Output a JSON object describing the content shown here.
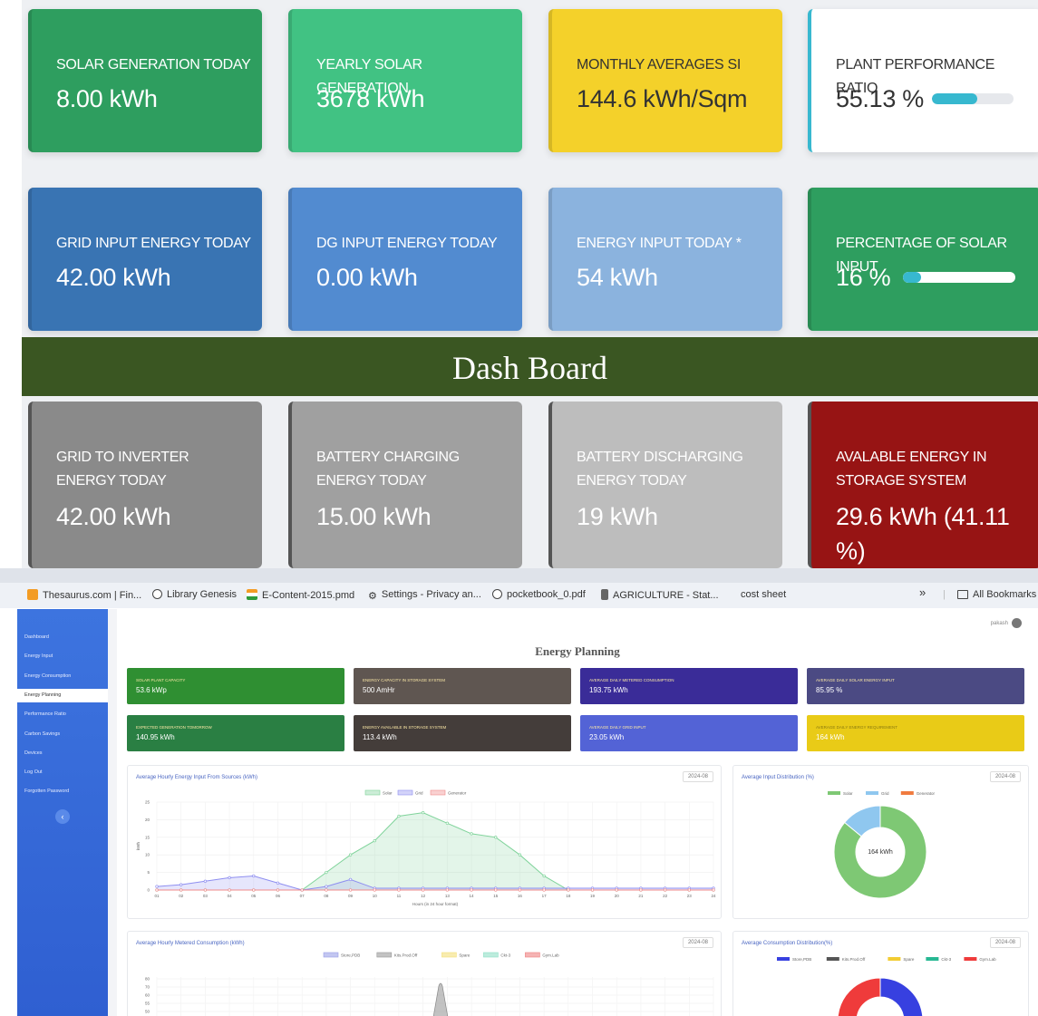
{
  "dashboard": {
    "row1": [
      {
        "label": "SOLAR GENERATION TODAY",
        "value": "8.00 kWh",
        "color": "#2e9e5f"
      },
      {
        "label": "YEARLY SOLAR GENERATION",
        "value": "3678 kWh",
        "color": "#41c283"
      },
      {
        "label": "MONTHLY AVERAGES SI",
        "value": "144.6 kWh/Sqm",
        "color": "#f4d12a"
      },
      {
        "label": "PLANT PERFORMANCE RATIO",
        "value": "55.13 %",
        "color": "#ffffff",
        "progress": 0.5513
      }
    ],
    "row2": [
      {
        "label": "GRID INPUT ENERGY TODAY",
        "value": "42.00 kWh",
        "color": "#3974b3"
      },
      {
        "label": "DG INPUT ENERGY TODAY",
        "value": "0.00 kWh",
        "color": "#528bd0"
      },
      {
        "label": "ENERGY INPUT TODAY *",
        "value": "54 kWh",
        "color": "#8bb3de"
      },
      {
        "label": "PERCENTAGE OF SOLAR INPUT",
        "value": "16 %",
        "color": "#2e9e5f",
        "progress": 0.16
      }
    ],
    "banner": "Dash Board",
    "row3": [
      {
        "label": "GRID TO INVERTER ENERGY TODAY",
        "value": "42.00 kWh",
        "color": "#8a8a8a"
      },
      {
        "label": "BATTERY CHARGING ENERGY TODAY",
        "value": "15.00 kWh",
        "color": "#a0a0a0"
      },
      {
        "label": "BATTERY DISCHARGING ENERGY TODAY",
        "value": "19 kWh",
        "color": "#bdbdbd"
      },
      {
        "label": "AVALABLE ENERGY IN STORAGE SYSTEM",
        "value": "29.6 kWh (41.11 %)",
        "color": "#971414"
      }
    ]
  },
  "browser": {
    "bookmarks": [
      "Thesaurus.com | Fin...",
      "Library Genesis",
      "E-Content-2015.pmd",
      "Settings - Privacy an...",
      "pocketbook_0.pdf",
      "AGRICULTURE - Stat...",
      "cost sheet"
    ],
    "more": "»",
    "all_bookmarks": "All Bookmarks"
  },
  "app": {
    "sidebar": [
      "Dashboard",
      "Energy Input",
      "Energy Consumption",
      "Energy Planning",
      "Performance Ratio",
      "Carbon Savings",
      "Devices",
      "Log Out",
      "Forgotten Password"
    ],
    "collapse": "‹",
    "user": "pakash",
    "title": "Energy Planning",
    "metrics_row1": [
      {
        "label": "SOLAR PLANT CAPACITY",
        "value": "53.6 kWp",
        "color": "#2f8f32"
      },
      {
        "label": "ENERGY CAPACITY IN STORAGE SYSTEM",
        "value": "500 AmHr",
        "color": "#5f5651"
      },
      {
        "label": "AVERAGE DAILY METERED CONSUMPTION",
        "value": "193.75 kWh",
        "color": "#3a2c98"
      },
      {
        "label": "AVERAGE DAILY SOLAR ENERGY INPUT",
        "value": "85.95 %",
        "color": "#4b4a83"
      }
    ],
    "metrics_row2": [
      {
        "label": "EXPECTED GENERATION TOMORROW",
        "value": "140.95 kWh",
        "color": "#2a7f43"
      },
      {
        "label": "ENERGY AVAILABLE IN STORAGE SYSTEM",
        "value": "113.4 kWh",
        "color": "#443d3a"
      },
      {
        "label": "AVERAGE DAILY GRID INPUT",
        "value": "23.05 kWh",
        "color": "#5363d6"
      },
      {
        "label": "AVERAGE DAILY ENERGY REQUIREMENT",
        "value": "164 kWh",
        "color": "#e9cb17"
      }
    ],
    "panels": {
      "hourly_input": {
        "title": "Average Hourly Energy Input From Sources (kWh)",
        "date": "2024-08",
        "xlabel": "Hours (in 24 hour format)",
        "ylabel": "kWh"
      },
      "input_dist": {
        "title": "Average Input Distribution (%)",
        "date": "2024-08",
        "center": "164 kWh"
      },
      "hourly_consumption": {
        "title": "Average Hourly Metered Consumption (kWh)",
        "date": "2024-08"
      },
      "consumption_dist": {
        "title": "Average Consumption Distribution(%)",
        "date": "2024-08"
      }
    }
  },
  "chart_data": [
    {
      "type": "area",
      "x": [
        "01",
        "02",
        "03",
        "04",
        "05",
        "06",
        "07",
        "08",
        "09",
        "10",
        "11",
        "12",
        "13",
        "14",
        "15",
        "16",
        "17",
        "18",
        "19",
        "20",
        "21",
        "22",
        "23",
        "24"
      ],
      "series": [
        {
          "name": "Solar",
          "color": "#7fd39a",
          "values": [
            0,
            0,
            0,
            0,
            0,
            0,
            0,
            5,
            10,
            14,
            21,
            22,
            19,
            16,
            15,
            10,
            4,
            0,
            0,
            0,
            0,
            0,
            0,
            0
          ]
        },
        {
          "name": "Grid",
          "color": "#8e8ef0",
          "values": [
            1,
            1.5,
            2.5,
            3.5,
            4,
            2,
            0,
            1,
            3,
            0.5,
            0.5,
            0.5,
            0.5,
            0.5,
            0.5,
            0.5,
            0.5,
            0.5,
            0.5,
            0.5,
            0.5,
            0.5,
            0.5,
            0.5
          ]
        },
        {
          "name": "Generator",
          "color": "#ef8a8a",
          "values": [
            0,
            0,
            0,
            0,
            0,
            0,
            0,
            0,
            0,
            0,
            0,
            0,
            0,
            0,
            0,
            0,
            0,
            0,
            0,
            0,
            0,
            0,
            0,
            0
          ]
        }
      ],
      "yticks": [
        0,
        5,
        10,
        15,
        20,
        25
      ],
      "ylim": [
        0,
        25
      ]
    },
    {
      "type": "pie",
      "categories": [
        "Solar",
        "Grid",
        "Generator"
      ],
      "values": [
        86,
        14,
        0
      ],
      "colors": [
        "#7ec874",
        "#8fc7ef",
        "#f07b3f"
      ]
    },
    {
      "type": "area",
      "series_names": [
        "Store,PDB",
        "Kits.Prod.Off",
        "Spare",
        "Ckt-3",
        "Gym.Lab"
      ],
      "colors": [
        "#9aa0e8",
        "#9a9a9a",
        "#f4e07a",
        "#8fe0c7",
        "#ef8080"
      ],
      "yticks": [
        50,
        55,
        60,
        70,
        80
      ]
    },
    {
      "type": "pie",
      "categories": [
        "Store,PDB",
        "Kits.Prod.Off",
        "Spare",
        "Ckt-3",
        "Gym.Lab"
      ],
      "values": [
        45,
        10,
        5,
        10,
        30
      ],
      "colors": [
        "#3740e0",
        "#555555",
        "#f2cc32",
        "#27b893",
        "#ef3b3b"
      ]
    }
  ]
}
